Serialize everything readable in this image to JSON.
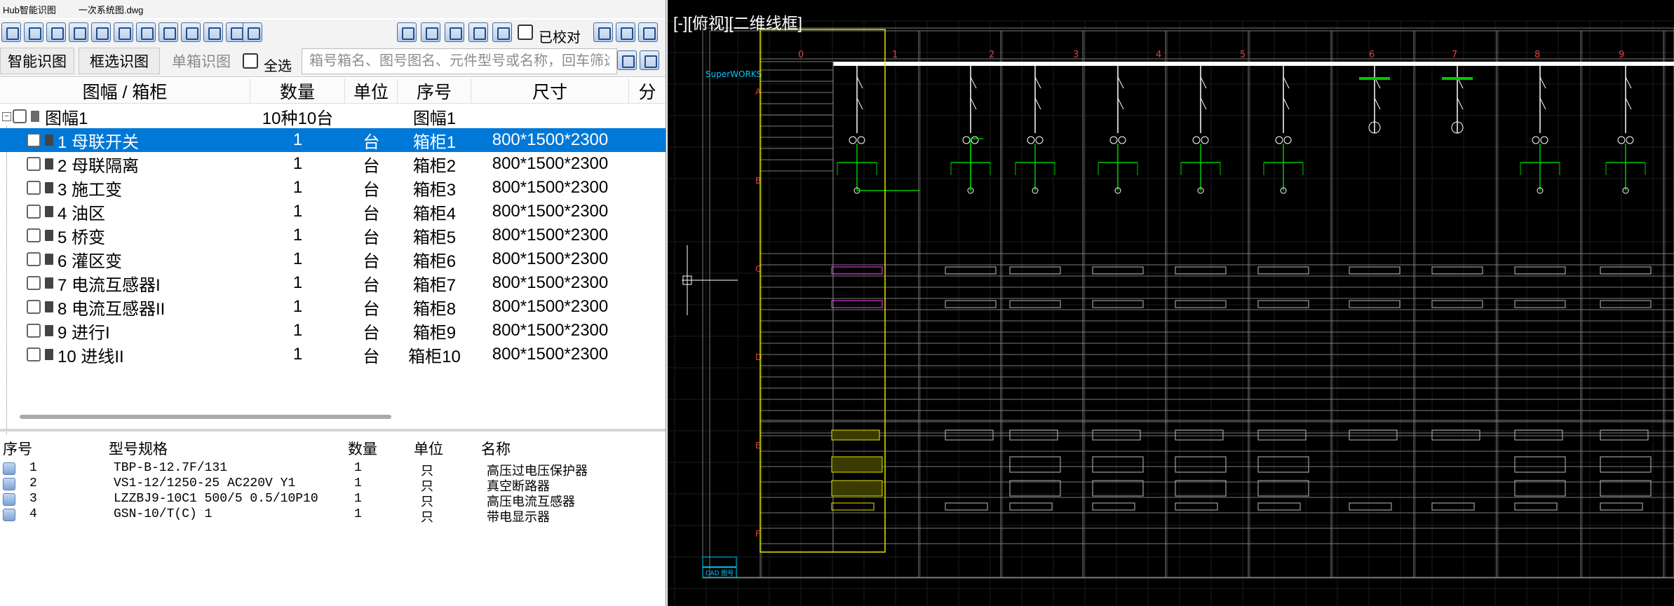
{
  "titlebar": {
    "app": "Hub智能识图",
    "file": "一次系统图.dwg"
  },
  "toolbar": {
    "verified_label": "已校对"
  },
  "row2": {
    "smart_btn": "智能识图",
    "box_btn": "框选识图",
    "single_btn": "单箱识图",
    "select_all": "全选",
    "search_placeholder": "箱号箱名、图号图名、元件型号或名称，回车筛选"
  },
  "grid": {
    "headers": [
      "图幅 / 箱柜",
      "数量",
      "单位",
      "序号",
      "尺寸",
      "分"
    ],
    "root": {
      "name": "图幅1",
      "qty": "10种10台",
      "unit": "",
      "seq": "图幅1",
      "size": ""
    },
    "rows": [
      {
        "name": "1 母联开关",
        "qty": "1",
        "unit": "台",
        "seq": "箱柜1",
        "size": "800*1500*2300"
      },
      {
        "name": "2 母联隔离",
        "qty": "1",
        "unit": "台",
        "seq": "箱柜2",
        "size": "800*1500*2300"
      },
      {
        "name": "3 施工变",
        "qty": "1",
        "unit": "台",
        "seq": "箱柜3",
        "size": "800*1500*2300"
      },
      {
        "name": "4 油区",
        "qty": "1",
        "unit": "台",
        "seq": "箱柜4",
        "size": "800*1500*2300"
      },
      {
        "name": "5 桥变",
        "qty": "1",
        "unit": "台",
        "seq": "箱柜5",
        "size": "800*1500*2300"
      },
      {
        "name": "6 灌区变",
        "qty": "1",
        "unit": "台",
        "seq": "箱柜6",
        "size": "800*1500*2300"
      },
      {
        "name": "7 电流互感器I",
        "qty": "1",
        "unit": "台",
        "seq": "箱柜7",
        "size": "800*1500*2300"
      },
      {
        "name": "8 电流互感器II",
        "qty": "1",
        "unit": "台",
        "seq": "箱柜8",
        "size": "800*1500*2300"
      },
      {
        "name": "9 进行I",
        "qty": "1",
        "unit": "台",
        "seq": "箱柜9",
        "size": "800*1500*2300"
      },
      {
        "name": "10 进线II",
        "qty": "1",
        "unit": "台",
        "seq": "箱柜10",
        "size": "800*1500*2300"
      }
    ]
  },
  "list": {
    "headers": [
      "序号",
      "型号规格",
      "数量",
      "单位",
      "名称"
    ],
    "rows": [
      {
        "seq": "1",
        "model": "TBP-B-12.7F/131",
        "qty": "1",
        "unit": "只",
        "name": "高压过电压保护器"
      },
      {
        "seq": "2",
        "model": "VS1-12/1250-25 AC220V Y1",
        "qty": "1",
        "unit": "只",
        "name": "真空断路器"
      },
      {
        "seq": "3",
        "model": "LZZBJ9-10C1 500/5 0.5/10P10",
        "qty": "1",
        "unit": "只",
        "name": "高压电流互感器"
      },
      {
        "seq": "4",
        "model": "GSN-10/T(C) 1",
        "qty": "1",
        "unit": "只",
        "name": "带电显示器"
      }
    ]
  },
  "cad": {
    "title": "[-][俯视][二维线框]",
    "brand": "SuperWORKS",
    "column_numbers": [
      "0",
      "1",
      "2",
      "3",
      "4",
      "5",
      "6",
      "7",
      "8",
      "9"
    ],
    "row_letters": [
      "A",
      "B",
      "C",
      "D",
      "E",
      "F"
    ],
    "footer_labels": [
      "CAD 图号"
    ]
  },
  "colors": {
    "selection": "#0078d7",
    "cad_bg": "#000000",
    "cad_green": "#00c800",
    "cad_cyan": "#00c8ff",
    "cad_yellow": "#e6e600",
    "cad_magenta": "#ff40ff"
  }
}
